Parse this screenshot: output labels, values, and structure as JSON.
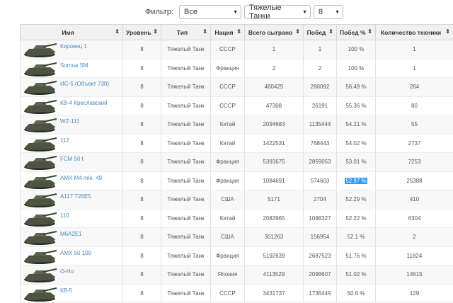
{
  "filter": {
    "label": "Фильтр:",
    "selects": [
      "Все",
      "Тяжелые Танки",
      "8"
    ]
  },
  "table": {
    "headers": [
      "Имя",
      "Уровень",
      "Тип",
      "Нация",
      "Всего сыграно",
      "Побед",
      "Побед %",
      "Количество техники"
    ],
    "rows": [
      {
        "name": "Кировец 1",
        "level": "8",
        "type": "Тяжелый Танк",
        "nation": "СССР",
        "total": "1",
        "wins": "1",
        "pct": "100 %",
        "count": "1"
      },
      {
        "name": "Somua SM",
        "level": "8",
        "type": "Тяжелый Танк",
        "nation": "Франция",
        "total": "2",
        "wins": "2",
        "pct": "100 %",
        "count": "1"
      },
      {
        "name": "ИС-5 (Объект 730)",
        "level": "8",
        "type": "Тяжелый Танк",
        "nation": "СССР",
        "total": "460425",
        "wins": "260092",
        "pct": "56.49 %",
        "count": "264"
      },
      {
        "name": "КВ-4 Креславский",
        "level": "8",
        "type": "Тяжелый Танк",
        "nation": "СССР",
        "total": "47308",
        "wins": "26191",
        "pct": "55.36 %",
        "count": "80"
      },
      {
        "name": "WZ-111",
        "level": "8",
        "type": "Тяжелый Танк",
        "nation": "Китай",
        "total": "2094683",
        "wins": "1135444",
        "pct": "54.21 %",
        "count": "55"
      },
      {
        "name": "112",
        "level": "8",
        "type": "Тяжелый Танк",
        "nation": "Китай",
        "total": "1422531",
        "wins": "768443",
        "pct": "54.02 %",
        "count": "2737"
      },
      {
        "name": "FCM 50 t",
        "level": "8",
        "type": "Тяжелый Танк",
        "nation": "Франция",
        "total": "5393675",
        "wins": "2859053",
        "pct": "53.01 %",
        "count": "7253"
      },
      {
        "name": "AMX M4 mle. 49",
        "level": "8",
        "type": "Тяжелый Танк",
        "nation": "Франция",
        "total": "1084691",
        "wins": "574603",
        "pct": "52.97 %",
        "count": "25388"
      },
      {
        "name": "A117 T26E5",
        "level": "8",
        "type": "Тяжелый Танк",
        "nation": "США",
        "total": "5171",
        "wins": "2704",
        "pct": "52.29 %",
        "count": "410"
      },
      {
        "name": "110",
        "level": "8",
        "type": "Тяжелый Танк",
        "nation": "Китай",
        "total": "2083965",
        "wins": "1088327",
        "pct": "52.22 %",
        "count": "6304"
      },
      {
        "name": "M6A2E1",
        "level": "8",
        "type": "Тяжелый Танк",
        "nation": "США",
        "total": "301263",
        "wins": "156954",
        "pct": "52.1 %",
        "count": "2"
      },
      {
        "name": "AMX 50 100",
        "level": "8",
        "type": "Тяжелый Танк",
        "nation": "Франция",
        "total": "5192639",
        "wins": "2687523",
        "pct": "51.76 %",
        "count": "11824"
      },
      {
        "name": "O-Ho",
        "level": "8",
        "type": "Тяжелый Танк",
        "nation": "Япония",
        "total": "4113529",
        "wins": "2098607",
        "pct": "51.02 %",
        "count": "14615"
      },
      {
        "name": "КВ-5",
        "level": "8",
        "type": "Тяжелый Танк",
        "nation": "СССР",
        "total": "3431737",
        "wins": "1736449",
        "pct": "50.6 %",
        "count": "129"
      }
    ]
  },
  "highlighted_row": 7
}
